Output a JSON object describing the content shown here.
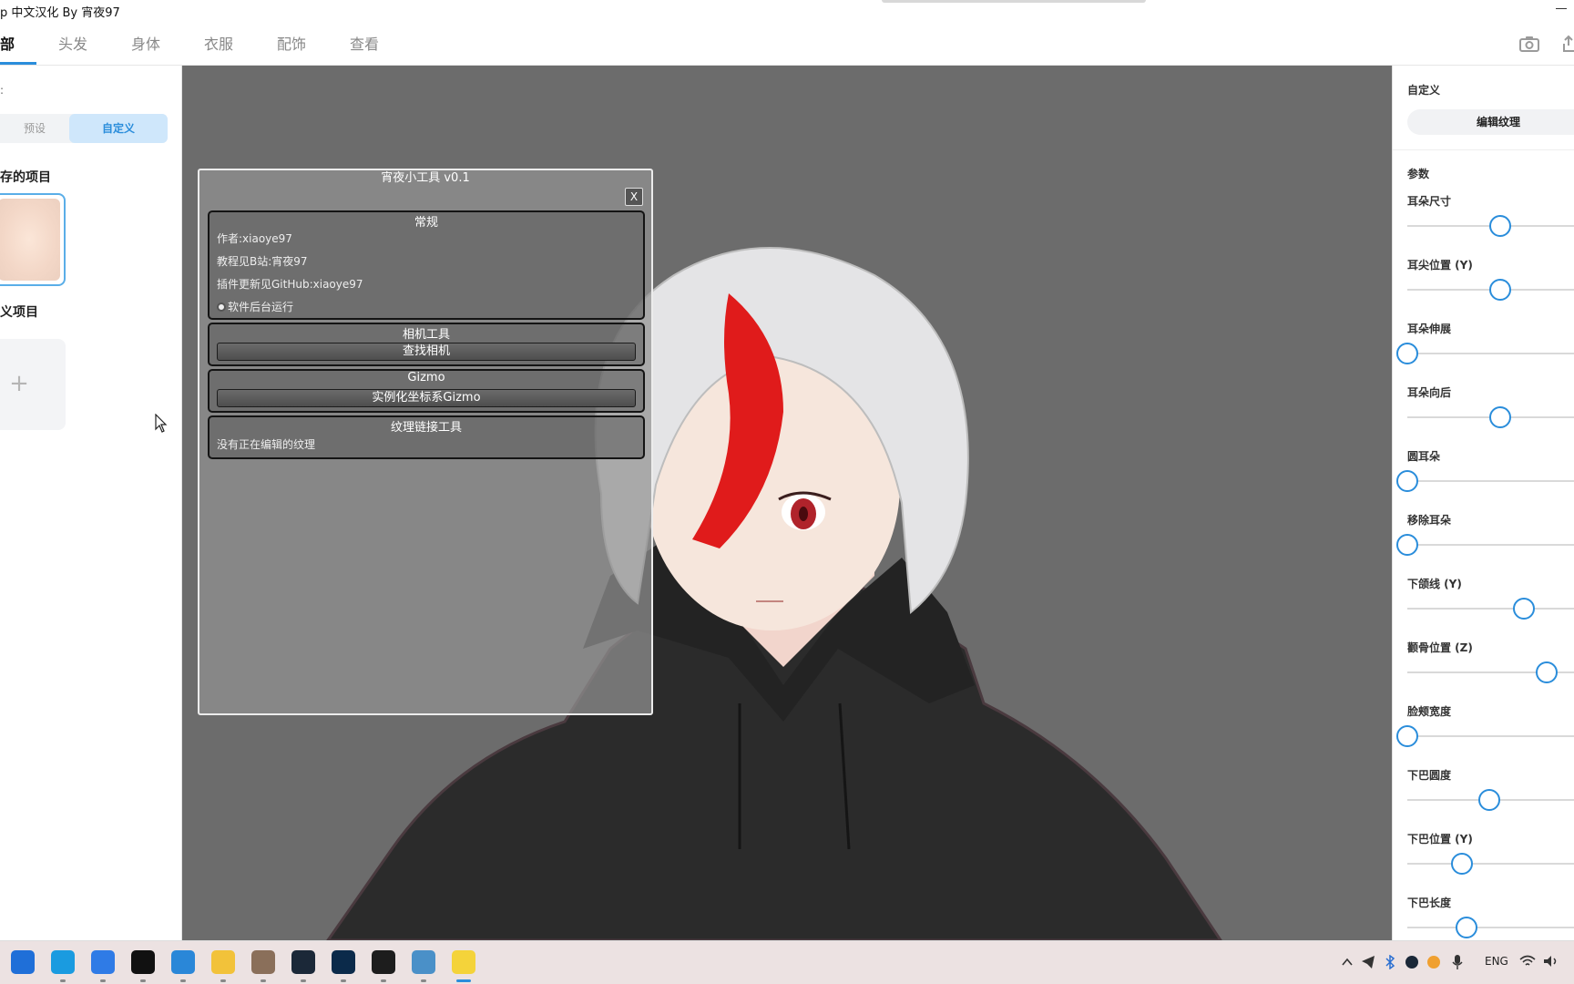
{
  "window": {
    "title": "p 中文汉化 By 宵夜97"
  },
  "nav": {
    "tabs": [
      {
        "label": "部"
      },
      {
        "label": "头发"
      },
      {
        "label": "身体"
      },
      {
        "label": "衣服"
      },
      {
        "label": "配饰"
      },
      {
        "label": "查看"
      }
    ],
    "icons": [
      "camera-icon",
      "export-icon"
    ]
  },
  "left": {
    "small_label": ":",
    "segment": {
      "preset": "预设",
      "custom": "自定义"
    },
    "saved_heading": "存的项目",
    "custom_heading": "义项目",
    "add_symbol": "+"
  },
  "tool": {
    "title": "宵夜小工具 v0.1",
    "close": "X",
    "general": {
      "heading": "常规",
      "author": "作者:xiaoye97",
      "tutorial": "教程见B站:宵夜97",
      "update": "插件更新见GitHub:xiaoye97",
      "background_run": "软件后台运行"
    },
    "camera": {
      "heading": "相机工具",
      "find_camera": "查找相机"
    },
    "gizmo": {
      "heading": "Gizmo",
      "instantiate": "实例化坐标系Gizmo"
    },
    "texture": {
      "heading": "纹理链接工具",
      "status": "没有正在编辑的纹理"
    }
  },
  "right": {
    "section": "自定义",
    "edit_texture": "编辑纹理",
    "params_label": "参数",
    "sliders": [
      {
        "label": "耳朵尺寸",
        "value": 0.6
      },
      {
        "label": "耳尖位置 (Y)",
        "value": 0.6
      },
      {
        "label": "耳朵伸展",
        "value": 0.0
      },
      {
        "label": "耳朵向后",
        "value": 0.6
      },
      {
        "label": "圆耳朵",
        "value": 0.0
      },
      {
        "label": "移除耳朵",
        "value": 0.0
      },
      {
        "label": "下颌线 (Y)",
        "value": 0.75
      },
      {
        "label": "颧骨位置 (Z)",
        "value": 0.9
      },
      {
        "label": "脸颊宽度",
        "value": 0.0
      },
      {
        "label": "下巴圆度",
        "value": 0.53
      },
      {
        "label": "下巴位置 (Y)",
        "value": 0.35
      },
      {
        "label": "下巴长度",
        "value": 0.38
      }
    ]
  },
  "taskbar": {
    "apps": [
      "windows-start-icon",
      "edge-icon",
      "todo-icon",
      "qq-icon",
      "vscode-icon",
      "file-explorer-icon",
      "avatar-app-icon",
      "steam-icon",
      "photoshop-icon",
      "telegram-icon",
      "game-icon",
      "app-icon"
    ],
    "tray_lang": "ENG"
  },
  "colors": {
    "accent": "#2a8ddb",
    "viewport": "#6c6c6c",
    "hair_red": "#e01b1b",
    "hoodie": "#2b2b2b"
  }
}
